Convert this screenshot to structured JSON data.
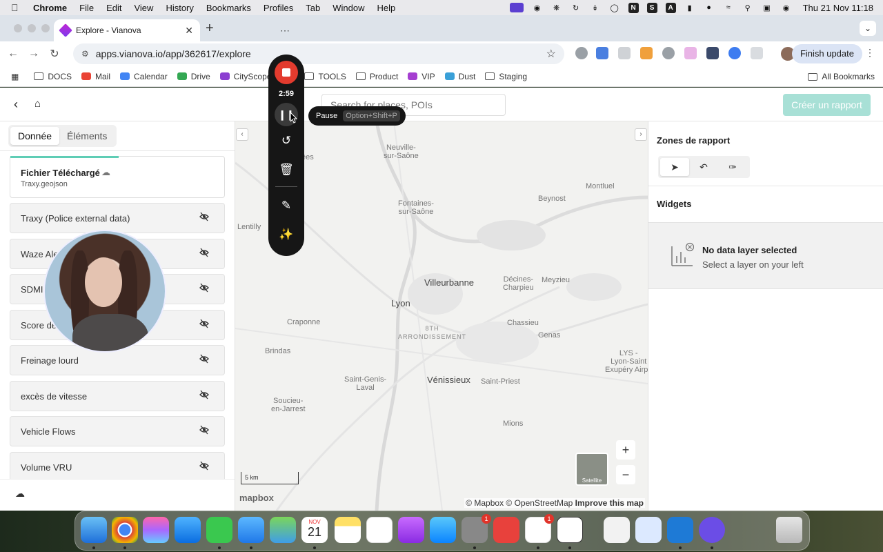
{
  "menubar": {
    "app_name": "Chrome",
    "items": [
      "File",
      "Edit",
      "View",
      "History",
      "Bookmarks",
      "Profiles",
      "Tab",
      "Window",
      "Help"
    ],
    "status_letters": [
      "N",
      "S",
      "A"
    ],
    "clock": "Thu 21 Nov  11:18"
  },
  "browser": {
    "tab_title": "Explore - Vianova",
    "url": "apps.vianova.io/app/362617/explore",
    "finish_update": "Finish update",
    "bookmarks": [
      "DOCS",
      "Mail",
      "Calendar",
      "Drive",
      "CityScope",
      "TOOLS",
      "Product",
      "VIP",
      "Dust",
      "Staging"
    ],
    "all_bookmarks": "All Bookmarks"
  },
  "header": {
    "search_placeholder": "Search for places, POIs",
    "create_report": "Créer un rapport"
  },
  "left_panel": {
    "tabs": [
      "Donnée",
      "Éléments"
    ],
    "active_tab": "Donnée",
    "file": {
      "title": "Fichier Téléchargé",
      "name": "Traxy.geojson"
    },
    "layers": [
      {
        "name": "Traxy (Police external data)"
      },
      {
        "name": "Waze Ale"
      },
      {
        "name": "SDMI"
      },
      {
        "name": "Score de"
      },
      {
        "name": "Freinage lourd"
      },
      {
        "name": "excès de vitesse"
      },
      {
        "name": "Vehicle Flows"
      },
      {
        "name": "Volume VRU"
      }
    ]
  },
  "recorder": {
    "time": "2:59",
    "tooltip_label": "Pause",
    "tooltip_shortcut": "Option+Shift+P"
  },
  "map": {
    "labels": [
      {
        "text": "Neuville-\nsur-Saône",
        "cls": ""
      },
      {
        "text": "Montluel",
        "cls": ""
      },
      {
        "text": "Beynost",
        "cls": ""
      },
      {
        "text": "Fontaines-\nsur-Saône",
        "cls": ""
      },
      {
        "text": "Lentilly",
        "cls": ""
      },
      {
        "text": "Villeurbanne",
        "cls": "big"
      },
      {
        "text": "Décines-\nCharpieu",
        "cls": ""
      },
      {
        "text": "Meyzieu",
        "cls": ""
      },
      {
        "text": "Lyon",
        "cls": "big"
      },
      {
        "text": "Craponne",
        "cls": ""
      },
      {
        "text": "8TH\nARRONDISSEMENT",
        "cls": "caps"
      },
      {
        "text": "Chassieu",
        "cls": ""
      },
      {
        "text": "Genas",
        "cls": ""
      },
      {
        "text": "Brindas",
        "cls": ""
      },
      {
        "text": "LYS -\nLyon-Saint\nExupéry Airpo",
        "cls": ""
      },
      {
        "text": "Saint-Genis-\nLaval",
        "cls": ""
      },
      {
        "text": "Vénissieux",
        "cls": "big"
      },
      {
        "text": "Saint-Priest",
        "cls": ""
      },
      {
        "text": "Soucieu-\nen-Jarrest",
        "cls": ""
      },
      {
        "text": "Mions",
        "cls": ""
      },
      {
        "text": "ées",
        "cls": ""
      }
    ],
    "scale": "5 km",
    "satellite": "Satellite",
    "logo": "mapbox",
    "attribution": "© Mapbox © OpenStreetMap",
    "improve": "Improve this map",
    "zoom_in": "+",
    "zoom_out": "−"
  },
  "right_panel": {
    "zones_title": "Zones de rapport",
    "widgets_title": "Widgets",
    "nodata_title": "No data layer selected",
    "nodata_sub": "Select a layer on your left"
  },
  "dock": {
    "calendar_month": "NOV",
    "calendar_day": "21",
    "badges": [
      "1",
      "1"
    ]
  }
}
